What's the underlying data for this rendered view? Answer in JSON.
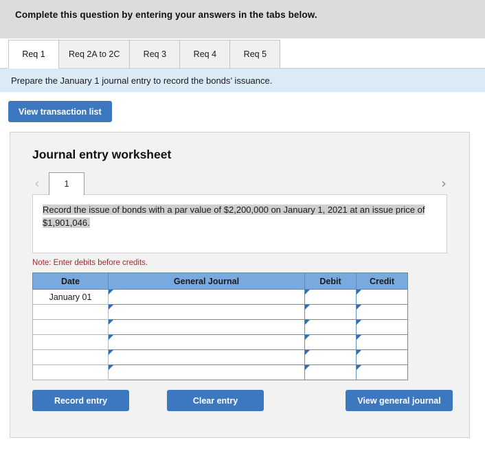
{
  "header": {
    "instruction": "Complete this question by entering your answers in the tabs below."
  },
  "tabs": [
    {
      "label": "Req 1",
      "active": true
    },
    {
      "label": "Req 2A to 2C",
      "active": false
    },
    {
      "label": "Req 3",
      "active": false
    },
    {
      "label": "Req 4",
      "active": false
    },
    {
      "label": "Req 5",
      "active": false
    }
  ],
  "requirement": {
    "text": "Prepare the January 1 journal entry to record the bonds’ issuance."
  },
  "toolbar": {
    "view_transaction_list": "View transaction list"
  },
  "worksheet": {
    "title": "Journal entry worksheet",
    "pager": {
      "prev_icon": "‹",
      "next_icon": "›",
      "current_page": "1"
    },
    "description": "Record the issue of bonds with a par value of $2,200,000 on January 1, 2021 at an issue price of $1,901,046.",
    "note": "Note: Enter debits before credits."
  },
  "table": {
    "columns": [
      "Date",
      "General Journal",
      "Debit",
      "Credit"
    ],
    "rows": [
      {
        "date": "January 01",
        "general_journal": "",
        "debit": "",
        "credit": ""
      },
      {
        "date": "",
        "general_journal": "",
        "debit": "",
        "credit": ""
      },
      {
        "date": "",
        "general_journal": "",
        "debit": "",
        "credit": ""
      },
      {
        "date": "",
        "general_journal": "",
        "debit": "",
        "credit": ""
      },
      {
        "date": "",
        "general_journal": "",
        "debit": "",
        "credit": ""
      },
      {
        "date": "",
        "general_journal": "",
        "debit": "",
        "credit": ""
      }
    ]
  },
  "footer": {
    "record_entry": "Record entry",
    "clear_entry": "Clear entry",
    "view_general_journal": "View general journal"
  },
  "colors": {
    "accent_blue": "#3b78bf",
    "table_header_blue": "#79a9df",
    "requirement_bar_blue": "#dbeaf7",
    "top_band_gray": "#dcdcdc",
    "panel_gray": "#f2f2f2",
    "note_red": "#a02c2c",
    "highlight_gray": "#cfcfcf"
  }
}
